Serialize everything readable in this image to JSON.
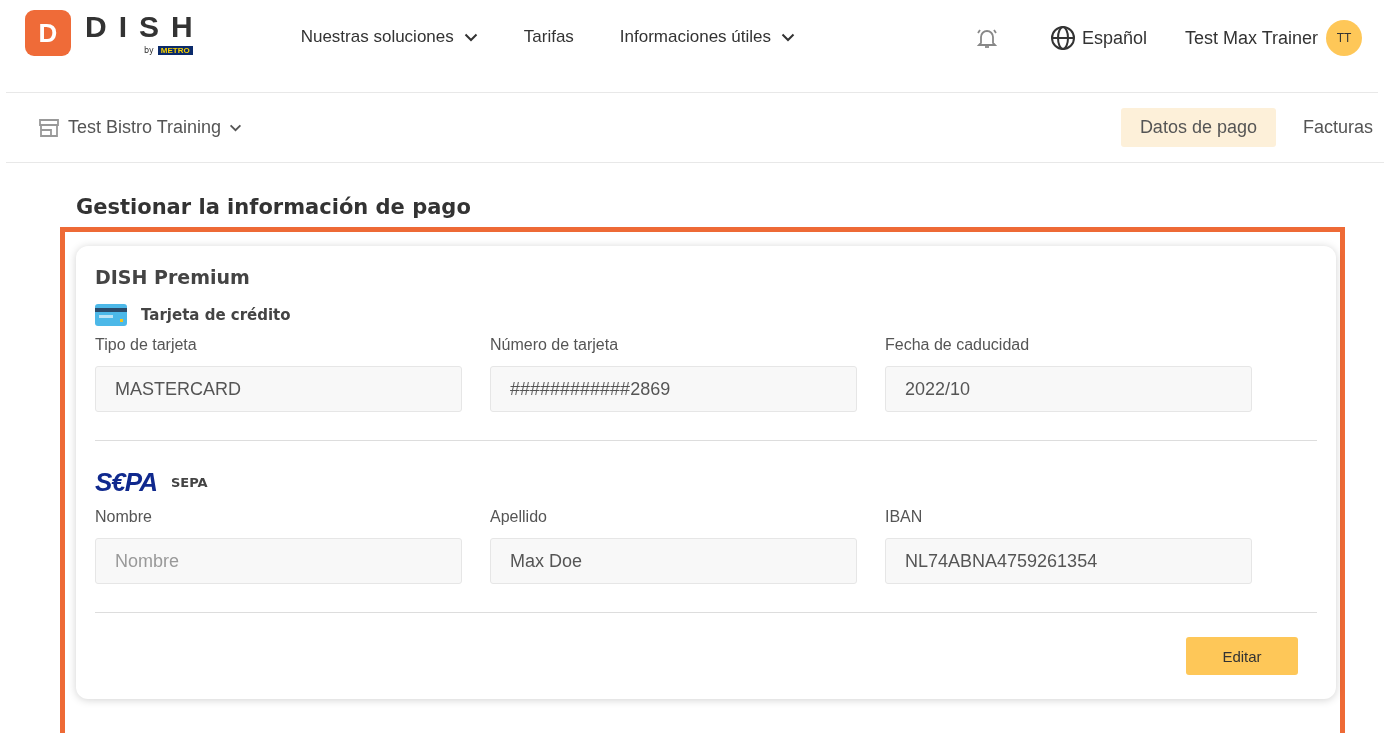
{
  "header": {
    "logo": {
      "letter": "D",
      "name": "DISH",
      "by": "by",
      "partner": "METRO"
    },
    "nav": [
      {
        "label": "Nuestras soluciones",
        "dropdown": true
      },
      {
        "label": "Tarifas",
        "dropdown": false
      },
      {
        "label": "Informaciones útiles",
        "dropdown": true
      }
    ],
    "language": "Español",
    "user": {
      "name": "Test Max Trainer",
      "initials": "TT"
    }
  },
  "subnav": {
    "store": "Test Bistro Training",
    "tabs": [
      {
        "label": "Datos de pago",
        "selected": true
      },
      {
        "label": "Facturas",
        "selected": false
      }
    ]
  },
  "page_title": "Gestionar la información de pago",
  "card": {
    "title": "DISH Premium",
    "sections": [
      {
        "kind": "card",
        "title": "Tarjeta de crédito",
        "fields": [
          {
            "label": "Tipo de tarjeta",
            "value": "MASTERCARD"
          },
          {
            "label": "Número de tarjeta",
            "value": "############2869"
          },
          {
            "label": "Fecha de caducidad",
            "value": "2022/10"
          }
        ]
      },
      {
        "kind": "sepa",
        "logo": "S€PA",
        "title": "SEPA",
        "fields": [
          {
            "label": "Nombre",
            "placeholder": "Nombre"
          },
          {
            "label": "Apellido",
            "value": "Max Doe"
          },
          {
            "label": "IBAN",
            "value": "NL74ABNA4759261354"
          }
        ]
      }
    ],
    "button": "Editar"
  }
}
